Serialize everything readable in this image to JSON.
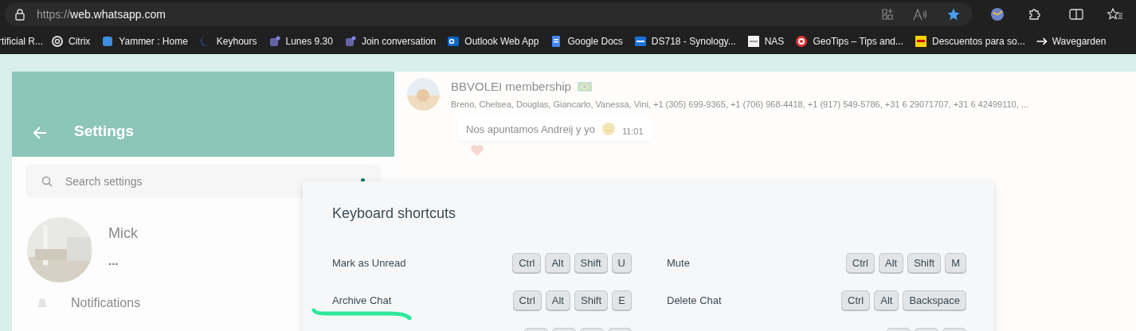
{
  "browser": {
    "address": {
      "scheme": "https://",
      "host": "web.whatsapp.com"
    },
    "bookmarks": [
      "rtificial R...",
      "Citrix",
      "Yammer : Home",
      "Keyhours",
      "Lunes 9.30",
      "Join conversation",
      "Outlook Web App",
      "Google Docs",
      "DS718 - Synology...",
      "NAS",
      "GeoTips – Tips and...",
      "Descuentos para so...",
      "Wavegarden"
    ]
  },
  "settings": {
    "title": "Settings",
    "search": {
      "placeholder": "Search settings"
    },
    "profile": {
      "name": "Mick",
      "status": "..."
    },
    "items": [
      "Notifications"
    ]
  },
  "chat": {
    "title": "BBVOLEI membership",
    "members": "Breno, Chelsea, Douglas, Giancarlo, Vanessa, Vini, +1 (305) 699-9365, +1 (706) 968-4418, +1 (917) 549-5786, +31 6 29071707, +31 6 42499110, ...",
    "message": {
      "text": "Nos apuntamos Andreij y yo",
      "time": "11:01"
    }
  },
  "dialog": {
    "title": "Keyboard shortcuts",
    "shortcuts": [
      {
        "label": "Mark as Unread",
        "keys": [
          "Ctrl",
          "Alt",
          "Shift",
          "U"
        ]
      },
      {
        "label": "Mute",
        "keys": [
          "Ctrl",
          "Alt",
          "Shift",
          "M"
        ]
      },
      {
        "label": "Archive Chat",
        "keys": [
          "Ctrl",
          "Alt",
          "Shift",
          "E"
        ]
      },
      {
        "label": "Delete Chat",
        "keys": [
          "Ctrl",
          "Alt",
          "Backspace"
        ]
      }
    ]
  }
}
